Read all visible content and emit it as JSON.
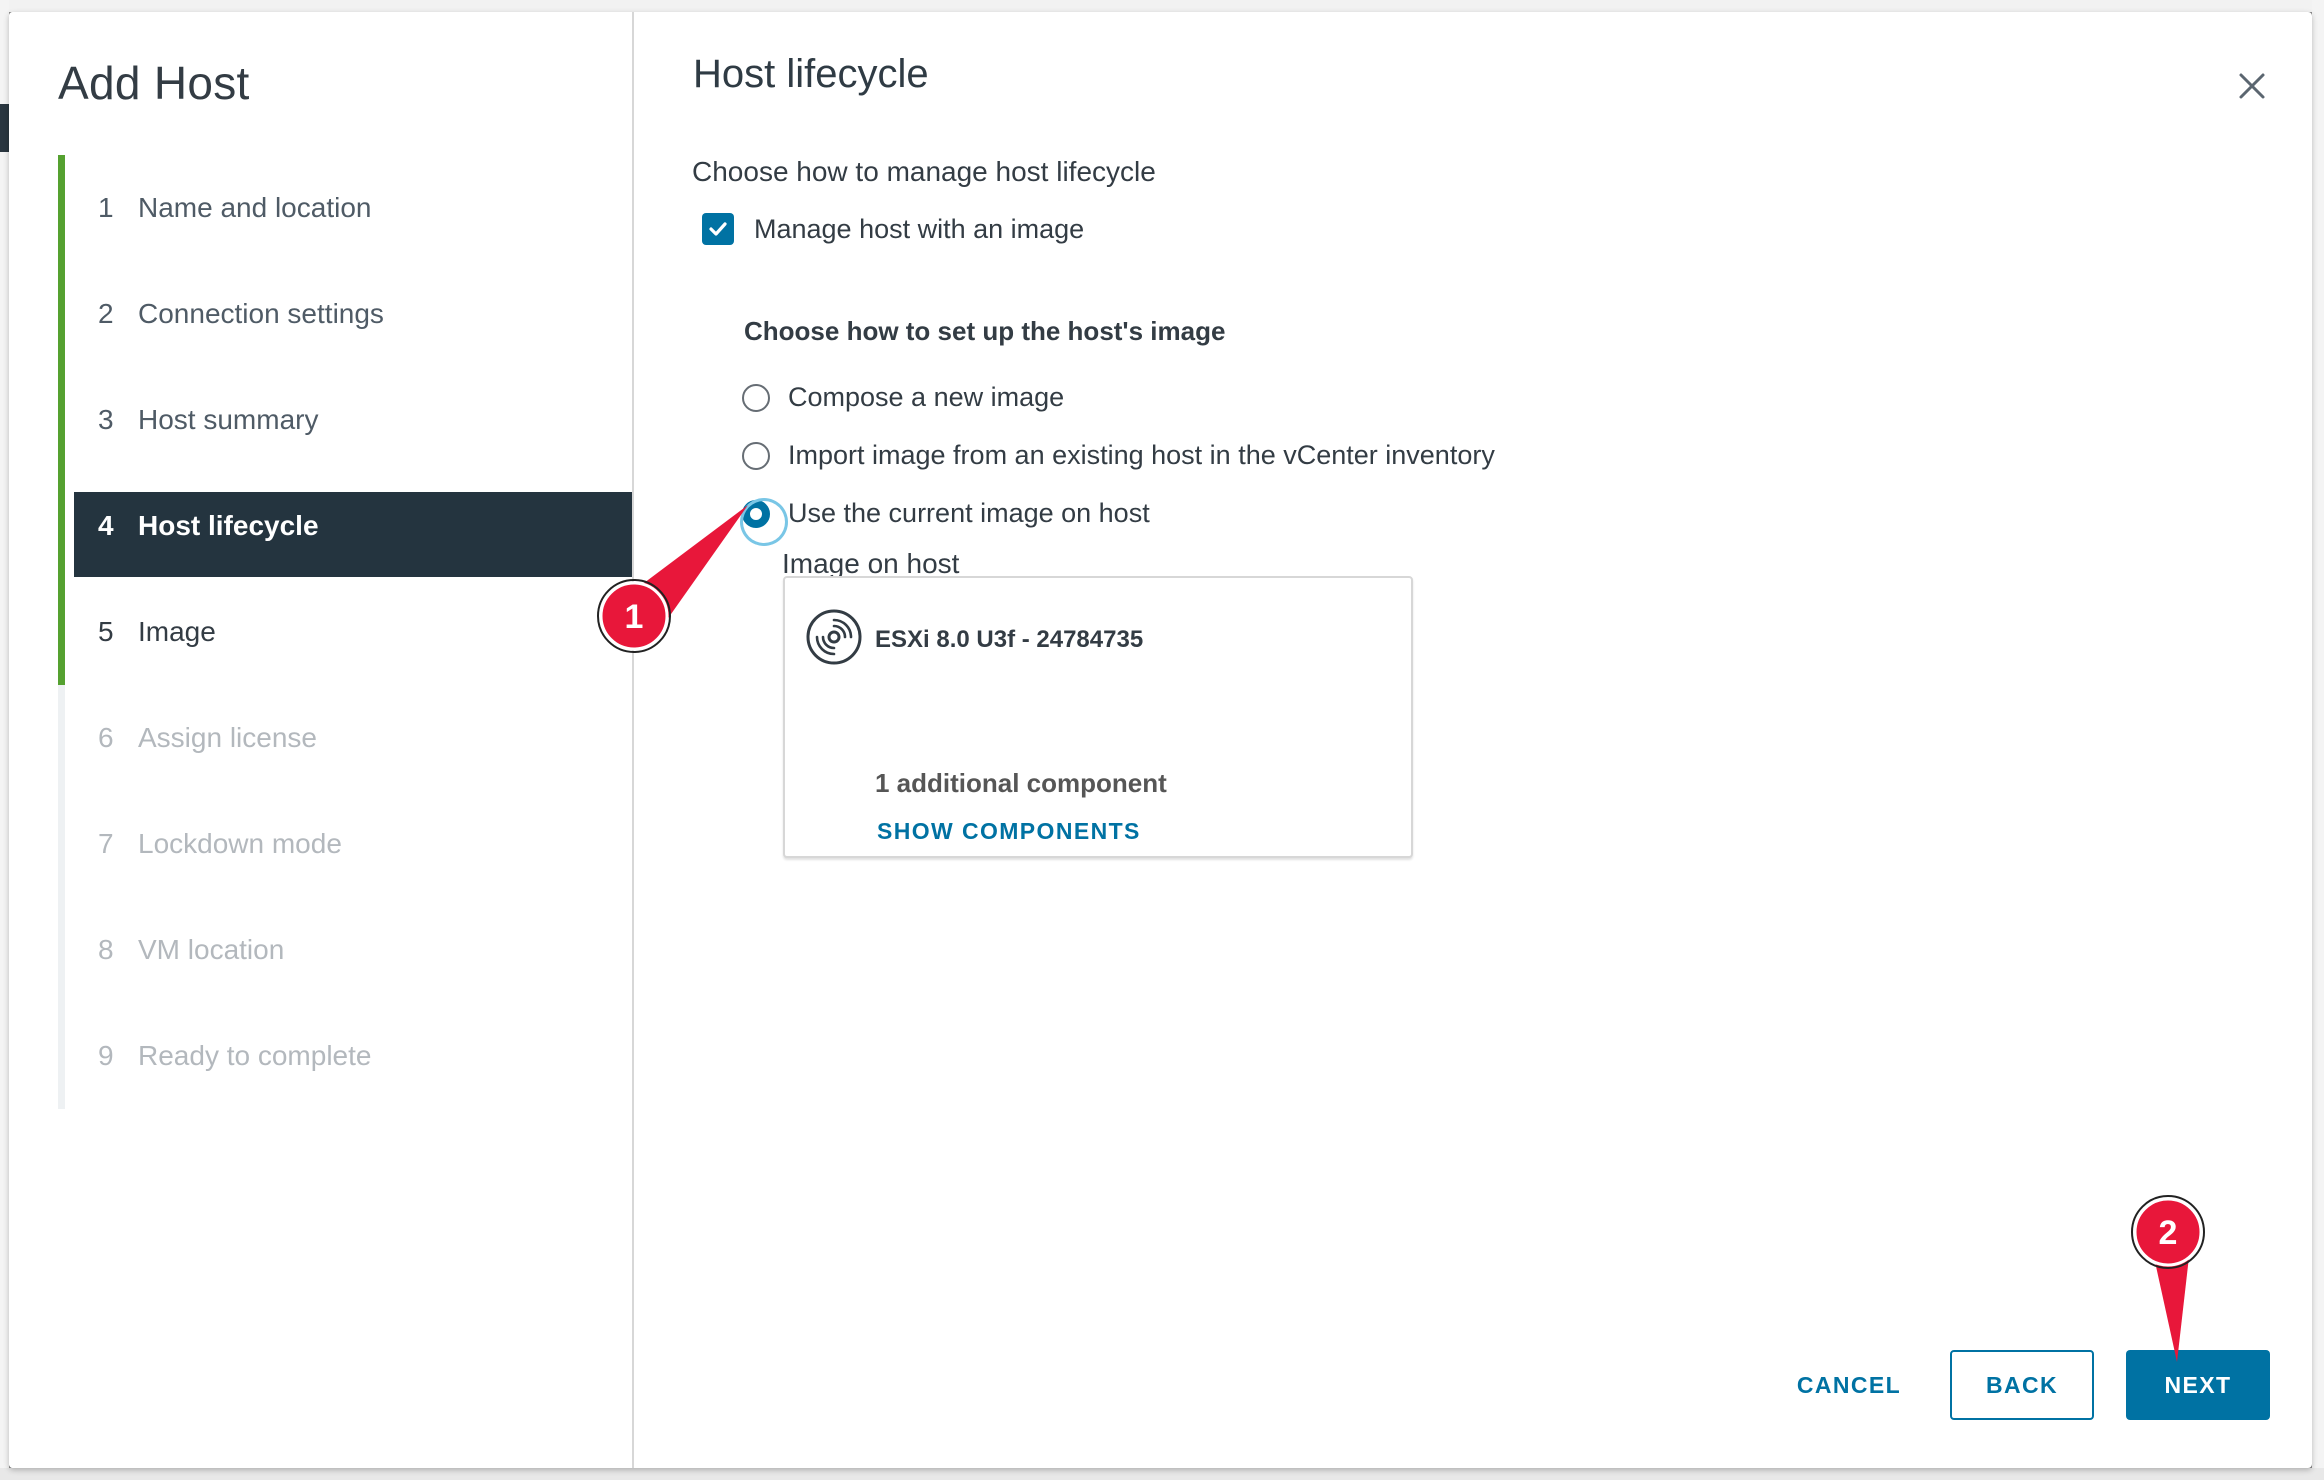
{
  "wizard": {
    "title": "Add Host",
    "steps": [
      {
        "num": "1",
        "label": "Name and location"
      },
      {
        "num": "2",
        "label": "Connection settings"
      },
      {
        "num": "3",
        "label": "Host summary"
      },
      {
        "num": "4",
        "label": "Host lifecycle"
      },
      {
        "num": "5",
        "label": "Image"
      },
      {
        "num": "6",
        "label": "Assign license"
      },
      {
        "num": "7",
        "label": "Lockdown mode"
      },
      {
        "num": "8",
        "label": "VM location"
      },
      {
        "num": "9",
        "label": "Ready to complete"
      }
    ],
    "current_step": 4
  },
  "page": {
    "title": "Host lifecycle",
    "section_label": "Choose how to manage host lifecycle",
    "manage_checkbox": {
      "label": "Manage host with an image",
      "checked": true
    },
    "image_setup": {
      "heading": "Choose how to set up the host's image",
      "options": [
        {
          "label": "Compose a new image",
          "selected": false
        },
        {
          "label": "Import image from an existing host in the vCenter inventory",
          "selected": false
        },
        {
          "label": "Use the current image on host",
          "selected": true
        }
      ]
    },
    "image_on_host": {
      "label": "Image on host",
      "name": "ESXi 8.0 U3f - 24784735",
      "components": "1 additional component",
      "show_components": "SHOW COMPONENTS"
    }
  },
  "footer": {
    "cancel": "CANCEL",
    "back": "BACK",
    "next": "NEXT"
  },
  "annotations": {
    "badge1": "1",
    "badge2": "2"
  },
  "colors": {
    "accent": "#0072a3",
    "progress": "#55a130",
    "current_step_bg": "#24343f",
    "annotation": "#e8173a"
  }
}
